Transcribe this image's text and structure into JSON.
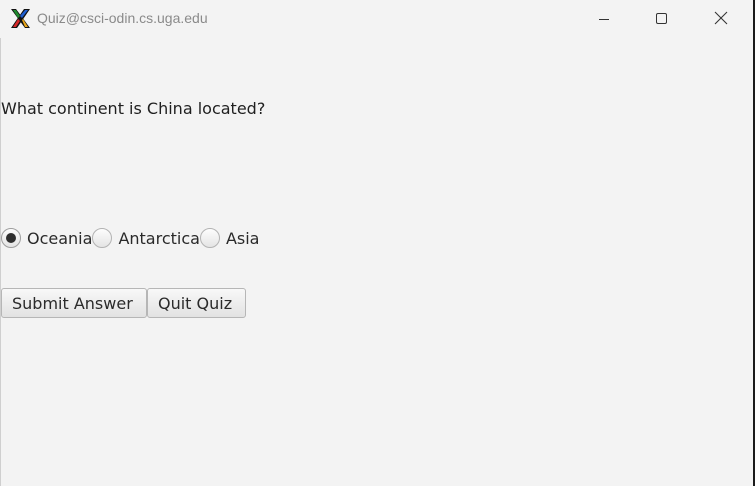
{
  "window": {
    "title": "Quiz@csci-odin.cs.uga.edu",
    "controls": [
      "minimize",
      "maximize",
      "close"
    ]
  },
  "quiz": {
    "question": "What continent is China located?",
    "options": [
      {
        "label": "Oceania",
        "selected": true
      },
      {
        "label": "Antarctica",
        "selected": false
      },
      {
        "label": "Asia",
        "selected": false
      }
    ],
    "submit_label": "Submit Answer",
    "quit_label": "Quit Quiz"
  },
  "icons": {
    "app": "x11-logo-icon",
    "minimize": "minimize-icon",
    "maximize": "maximize-icon",
    "close": "close-icon"
  },
  "colors": {
    "background": "#f3f3f3",
    "title_text": "#8a8a8a",
    "text": "#1f1f1f"
  }
}
